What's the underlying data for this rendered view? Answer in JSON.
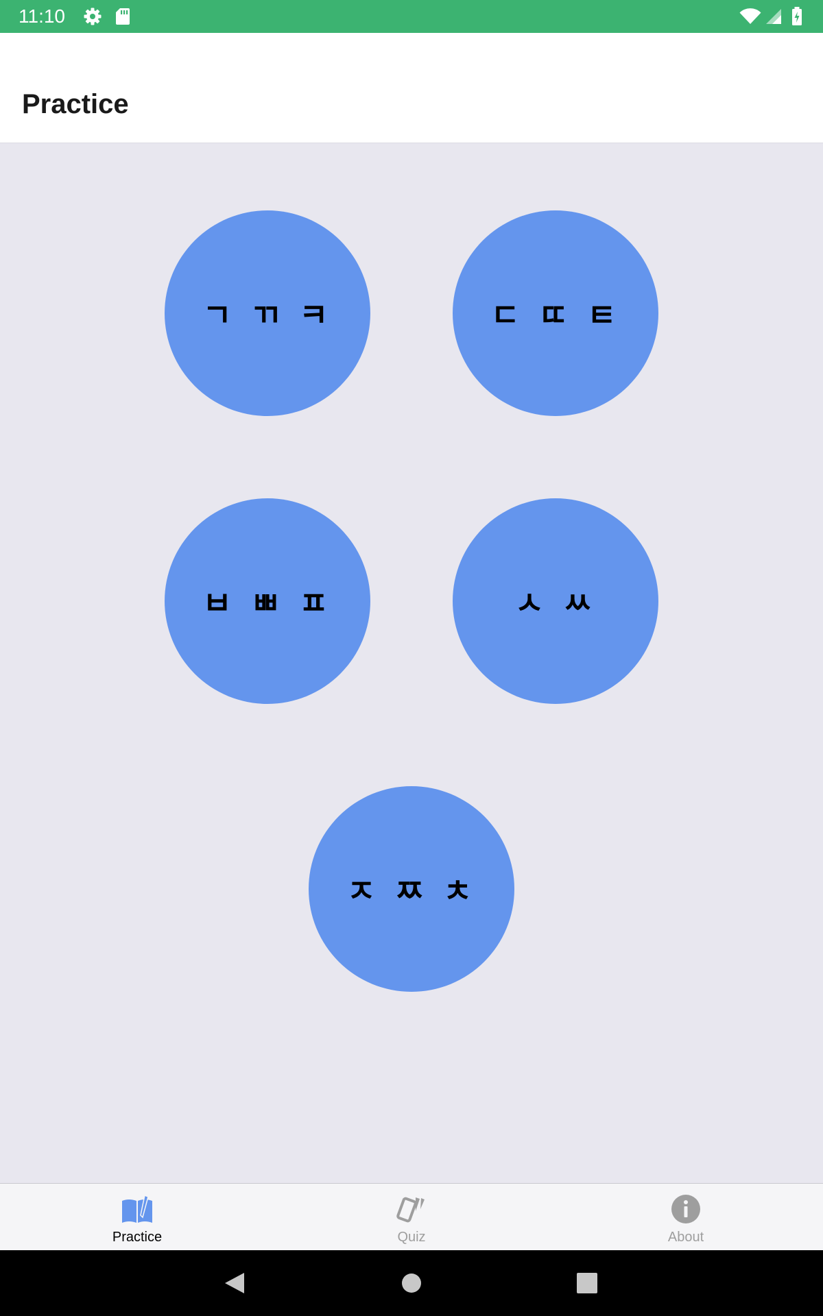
{
  "status_bar": {
    "time": "11:10",
    "icons": [
      "gear-icon",
      "sd-card-icon",
      "wifi-icon",
      "signal-icon",
      "battery-charging-icon"
    ],
    "background": "#3cb371"
  },
  "header": {
    "title": "Practice"
  },
  "practice_groups": [
    {
      "label": "ㄱ ㄲ ㅋ"
    },
    {
      "label": "ㄷ ㄸ ㅌ"
    },
    {
      "label": "ㅂ ㅃ ㅍ"
    },
    {
      "label": "ㅅ ㅆ"
    },
    {
      "label": "ㅈ ㅉ ㅊ"
    }
  ],
  "tabs": [
    {
      "label": "Practice",
      "icon": "book-icon",
      "active": true
    },
    {
      "label": "Quiz",
      "icon": "cards-icon",
      "active": false
    },
    {
      "label": "About",
      "icon": "info-icon",
      "active": false
    }
  ],
  "nav_bar": {
    "buttons": [
      "back-icon",
      "home-icon",
      "recents-icon"
    ]
  },
  "colors": {
    "accent": "#6495ed",
    "background": "#e8e7ef",
    "tab_active_text": "#000000",
    "tab_inactive": "#9e9e9e"
  }
}
